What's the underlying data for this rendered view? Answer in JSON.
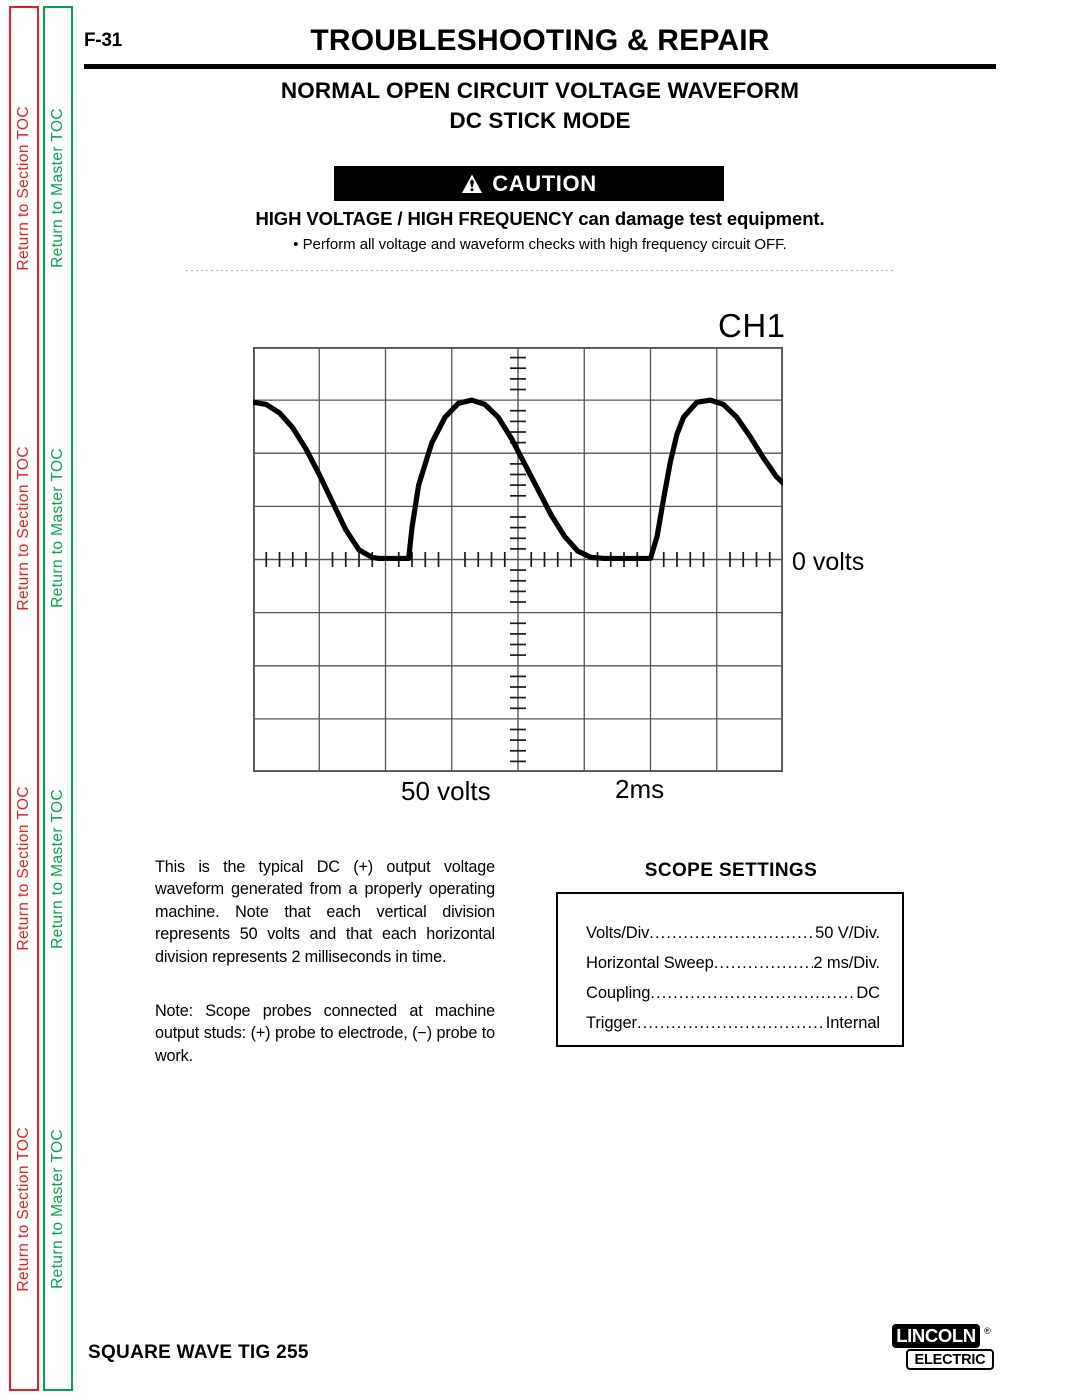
{
  "sidebar": {
    "section_toc_label": "Return to Section TOC",
    "master_toc_label": "Return to Master TOC",
    "section_toc_color": "#ed1c24",
    "master_toc_color": "#00a651",
    "repeat_count": 4
  },
  "header": {
    "page_number": "F-31",
    "doc_title": "TROUBLESHOOTING & REPAIR",
    "subtitle_line1": "NORMAL OPEN CIRCUIT VOLTAGE WAVEFORM",
    "subtitle_line2": "DC STICK MODE"
  },
  "caution": {
    "banner_label": "CAUTION",
    "icon": "warning-triangle-icon",
    "headline": "HIGH VOLTAGE / HIGH FREQUENCY can damage test equipment.",
    "bullet": "• Perform all voltage and waveform checks with high frequency circuit OFF."
  },
  "scope": {
    "channel_label": "CH1",
    "zero_label": "0 volts",
    "volts_per_div_label": "50 volts",
    "time_per_div_label": "2ms"
  },
  "body": {
    "paragraph_1": "This is the typical DC (+) output voltage waveform generated from a properly operating machine.  Note that each vertical division represents 50 volts and that each horizontal division represents 2 milliseconds in time.",
    "paragraph_2": "Note: Scope probes connected at machine output studs: (+) probe to electrode, (−) probe to work."
  },
  "scope_settings": {
    "title": "SCOPE SETTINGS",
    "rows": [
      {
        "label": "Volts/Div",
        "value": "50 V/Div."
      },
      {
        "label": "Horizontal Sweep ",
        "value": "2 ms/Div."
      },
      {
        "label": "Coupling ",
        "value": "DC"
      },
      {
        "label": "Trigger ",
        "value": "Internal"
      }
    ]
  },
  "footer": {
    "model": "SQUARE WAVE TIG 255",
    "logo_top": "LINCOLN",
    "logo_registered": "®",
    "logo_bottom": "ELECTRIC"
  },
  "chart_data": {
    "type": "line",
    "title": "CH1",
    "xlabel": "2ms",
    "ylabel": "50 volts",
    "grid": true,
    "divisions_x": 8,
    "divisions_y": 8,
    "volts_per_division": 50,
    "ms_per_division": 2,
    "zero_line_division_from_top": 4,
    "minor_ticks_per_division": 5,
    "xlim": [
      0,
      16
    ],
    "ylim": [
      -200,
      200
    ],
    "annotations": [
      "CH1",
      "0 volts",
      "50 volts",
      "2ms"
    ],
    "series": [
      {
        "name": "DC (+) output voltage",
        "x": [
          0.0,
          0.4,
          0.8,
          1.2,
          1.6,
          2.0,
          2.4,
          2.8,
          3.2,
          3.6,
          3.8,
          4.0,
          4.2,
          4.4,
          4.6,
          4.7,
          4.8,
          5.0,
          5.4,
          5.8,
          6.2,
          6.6,
          7.0,
          7.4,
          7.8,
          8.0,
          8.2,
          8.6,
          9.0,
          9.4,
          9.8,
          10.2,
          10.6,
          11.0,
          11.3,
          11.6,
          11.8,
          12.0,
          12.2,
          12.4,
          12.6,
          12.8,
          13.0,
          13.4,
          13.8,
          14.2,
          14.6,
          15.0,
          15.4,
          15.8,
          16.0
        ],
        "y_volts": [
          148,
          146,
          138,
          124,
          104,
          80,
          54,
          28,
          9,
          2,
          1,
          1,
          1,
          1,
          1,
          1,
          30,
          70,
          110,
          134,
          147,
          150,
          146,
          134,
          114,
          102,
          90,
          66,
          42,
          22,
          8,
          2,
          1,
          1,
          1,
          1,
          1,
          1,
          22,
          58,
          92,
          118,
          134,
          148,
          150,
          146,
          134,
          116,
          96,
          78,
          72
        ]
      }
    ]
  }
}
